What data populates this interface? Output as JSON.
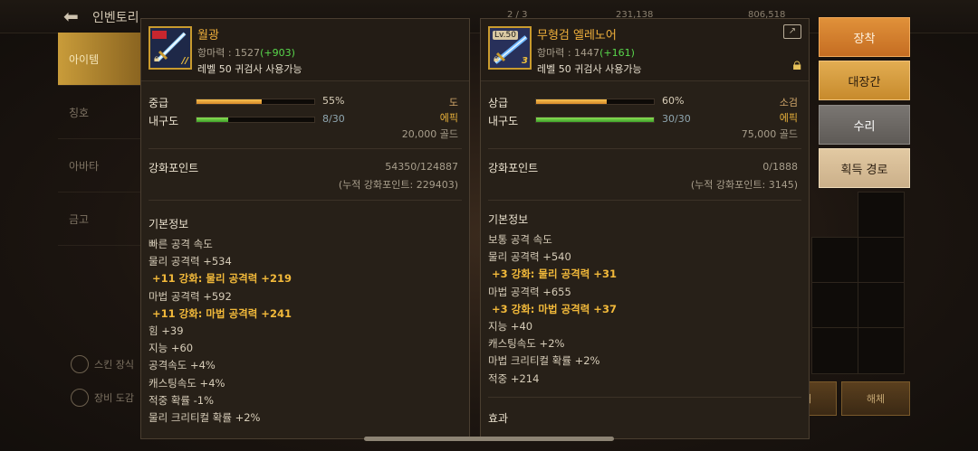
{
  "background": {
    "title": "인벤토리",
    "top_numbers": [
      "2 / 3",
      "231,138",
      "806,518"
    ],
    "nav": [
      "아이템",
      "칭호",
      "아바타",
      "금고"
    ],
    "left_buttons": [
      "스킨 장식",
      "장비 도감"
    ],
    "bottom_buttons": [
      "판매",
      "해체"
    ]
  },
  "left_item": {
    "name": "월광",
    "power_label": "항마력 : 1527",
    "power_bonus": "(+903)",
    "requirement": "레벨 50 귀검사 사용가능",
    "grade_label": "중급",
    "grade_pct": "55%",
    "grade_value": 0.55,
    "durability_label": "내구도",
    "durability": "8/30",
    "durability_value": 0.267,
    "category": "도",
    "rarity": "에픽",
    "price": "20,000 골드",
    "points_label": "강화포인트",
    "points": "54350/124887",
    "points_cumulative": "(누적 강화포인트: 229403)",
    "basic_info": "기본정보",
    "stats": [
      {
        "text": "빠른 공격 속도",
        "bold": false
      },
      {
        "text": "물리 공격력 +534",
        "bold": false
      },
      {
        "text": "+11 강화: 물리 공격력 +219",
        "bold": true
      },
      {
        "text": "마법 공격력 +592",
        "bold": false
      },
      {
        "text": "+11 강화: 마법 공격력 +241",
        "bold": true
      },
      {
        "text": "힘 +39",
        "bold": false
      },
      {
        "text": "지능 +60",
        "bold": false
      },
      {
        "text": "공격속도 +4%",
        "bold": false
      },
      {
        "text": "캐스팅속도 +4%",
        "bold": false
      },
      {
        "text": "적중 확률 -1%",
        "bold": false
      },
      {
        "text": "물리 크리티컬 확률 +2%",
        "bold": false
      }
    ]
  },
  "right_item": {
    "level_badge": "Lv.50",
    "star_badge": "3",
    "name": "무형검 엘레노어",
    "power_label": "항마력 : 1447",
    "power_bonus": "(+161)",
    "requirement": "레벨 50 귀검사 사용가능",
    "grade_label": "상급",
    "grade_pct": "60%",
    "grade_value": 0.6,
    "durability_label": "내구도",
    "durability": "30/30",
    "durability_value": 1.0,
    "category": "소검",
    "rarity": "에픽",
    "price": "75,000 골드",
    "points_label": "강화포인트",
    "points": "0/1888",
    "points_cumulative": "(누적 강화포인트: 3145)",
    "basic_info": "기본정보",
    "effect_label": "효과",
    "stats": [
      {
        "text": "보통 공격 속도",
        "bold": false
      },
      {
        "text": "물리 공격력 +540",
        "bold": false
      },
      {
        "text": "+3 강화: 물리 공격력 +31",
        "bold": true
      },
      {
        "text": "마법 공격력 +655",
        "bold": false
      },
      {
        "text": "+3 강화: 마법 공격력 +37",
        "bold": true
      },
      {
        "text": "지능 +40",
        "bold": false
      },
      {
        "text": "캐스팅속도 +2%",
        "bold": false
      },
      {
        "text": "마법 크리티컬 확률 +2%",
        "bold": false
      },
      {
        "text": "적중 +214",
        "bold": false
      }
    ]
  },
  "actions": {
    "equip": "장착",
    "blacksmith": "대장간",
    "repair": "수리",
    "acquire_route": "획득 경로"
  },
  "colors": {
    "accent_orange": "#e0913a",
    "bonus_green": "#59d84c",
    "enhance_gold": "#f2b93a",
    "item_name": "#f0b03c"
  }
}
